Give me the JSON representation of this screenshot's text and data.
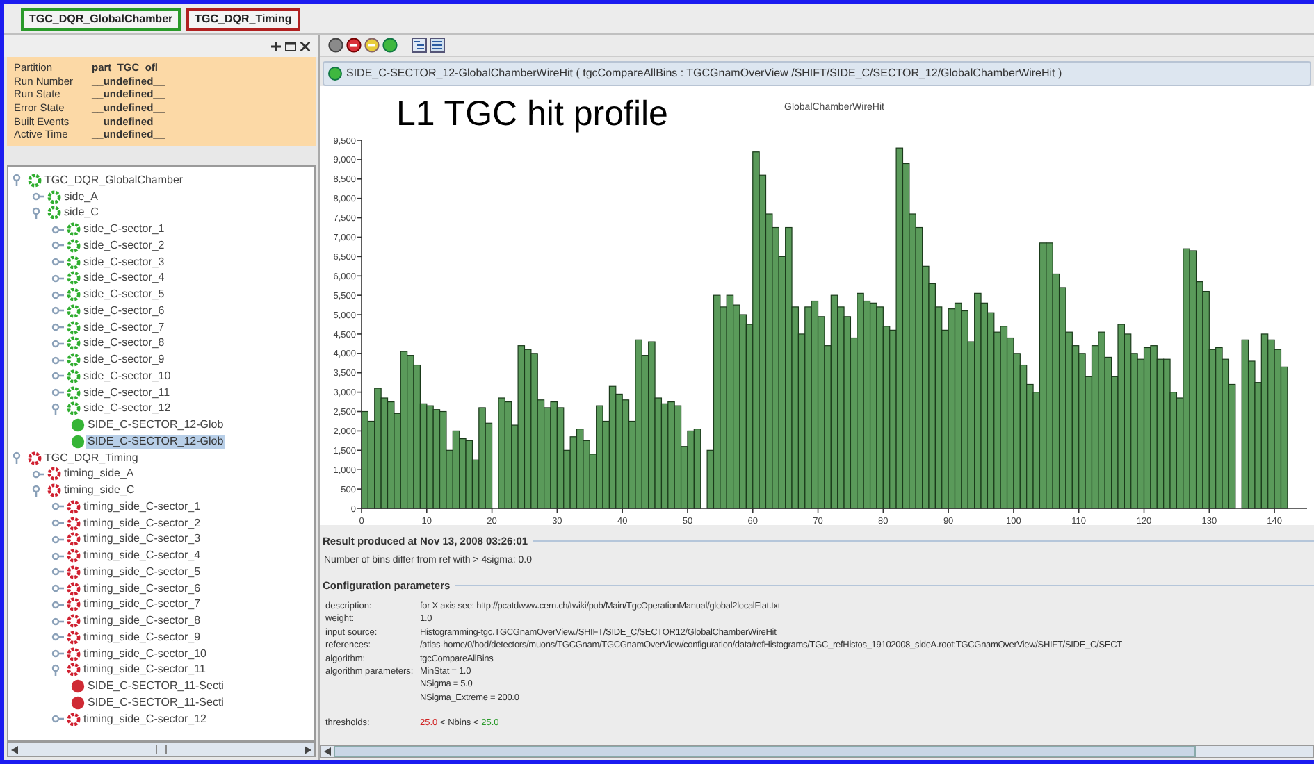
{
  "tabs": [
    {
      "label": "TGC_DQR_GlobalChamber",
      "color": "#2a9a2a"
    },
    {
      "label": "TGC_DQR_Timing",
      "color": "#b02020"
    }
  ],
  "status_panel": {
    "rows": [
      {
        "label": "Partition",
        "value": "part_TGC_ofl"
      },
      {
        "label": "Run Number",
        "value": "__undefined__"
      },
      {
        "label": "Run State",
        "value": "__undefined__"
      },
      {
        "label": "Error State",
        "value": "__undefined__"
      },
      {
        "label": "Built Events",
        "value": "__undefined__"
      },
      {
        "label": "Active Time",
        "value": "__undefined__"
      }
    ]
  },
  "tree": [
    {
      "label": "TGC_DQR_GlobalChamber",
      "kind": "group",
      "color": "#2fae2f",
      "expanded": true,
      "selected": false,
      "children": [
        {
          "label": "side_A",
          "kind": "group",
          "color": "#2fae2f",
          "expanded": false,
          "selected": false
        },
        {
          "label": "side_C",
          "kind": "group",
          "color": "#2fae2f",
          "expanded": true,
          "selected": false,
          "children": [
            {
              "label": "side_C-sector_1",
              "kind": "group",
              "color": "#2fae2f",
              "expanded": false,
              "selected": false
            },
            {
              "label": "side_C-sector_2",
              "kind": "group",
              "color": "#2fae2f",
              "expanded": false,
              "selected": false
            },
            {
              "label": "side_C-sector_3",
              "kind": "group",
              "color": "#2fae2f",
              "expanded": false,
              "selected": false
            },
            {
              "label": "side_C-sector_4",
              "kind": "group",
              "color": "#2fae2f",
              "expanded": false,
              "selected": false
            },
            {
              "label": "side_C-sector_5",
              "kind": "group",
              "color": "#2fae2f",
              "expanded": false,
              "selected": false
            },
            {
              "label": "side_C-sector_6",
              "kind": "group",
              "color": "#2fae2f",
              "expanded": false,
              "selected": false
            },
            {
              "label": "side_C-sector_7",
              "kind": "group",
              "color": "#2fae2f",
              "expanded": false,
              "selected": false
            },
            {
              "label": "side_C-sector_8",
              "kind": "group",
              "color": "#2fae2f",
              "expanded": false,
              "selected": false
            },
            {
              "label": "side_C-sector_9",
              "kind": "group",
              "color": "#2fae2f",
              "expanded": false,
              "selected": false
            },
            {
              "label": "side_C-sector_10",
              "kind": "group",
              "color": "#2fae2f",
              "expanded": false,
              "selected": false
            },
            {
              "label": "side_C-sector_11",
              "kind": "group",
              "color": "#2fae2f",
              "expanded": false,
              "selected": false
            },
            {
              "label": "side_C-sector_12",
              "kind": "group",
              "color": "#2fae2f",
              "expanded": true,
              "selected": false,
              "children": [
                {
                  "label": "SIDE_C-SECTOR_12-Glob",
                  "kind": "leaf",
                  "color": "#36b536",
                  "selected": false
                },
                {
                  "label": "SIDE_C-SECTOR_12-Glob",
                  "kind": "leaf",
                  "color": "#36b536",
                  "selected": true
                }
              ]
            }
          ]
        }
      ]
    },
    {
      "label": "TGC_DQR_Timing",
      "kind": "group",
      "color": "#d02030",
      "expanded": true,
      "selected": false,
      "children": [
        {
          "label": "timing_side_A",
          "kind": "group",
          "color": "#d02030",
          "expanded": false,
          "selected": false
        },
        {
          "label": "timing_side_C",
          "kind": "group",
          "color": "#d02030",
          "expanded": true,
          "selected": false,
          "children": [
            {
              "label": "timing_side_C-sector_1",
              "kind": "group",
              "color": "#d02030",
              "expanded": false,
              "selected": false
            },
            {
              "label": "timing_side_C-sector_2",
              "kind": "group",
              "color": "#d02030",
              "expanded": false,
              "selected": false
            },
            {
              "label": "timing_side_C-sector_3",
              "kind": "group",
              "color": "#d02030",
              "expanded": false,
              "selected": false
            },
            {
              "label": "timing_side_C-sector_4",
              "kind": "group",
              "color": "#d02030",
              "expanded": false,
              "selected": false
            },
            {
              "label": "timing_side_C-sector_5",
              "kind": "group",
              "color": "#d02030",
              "expanded": false,
              "selected": false
            },
            {
              "label": "timing_side_C-sector_6",
              "kind": "group",
              "color": "#d02030",
              "expanded": false,
              "selected": false
            },
            {
              "label": "timing_side_C-sector_7",
              "kind": "group",
              "color": "#d02030",
              "expanded": false,
              "selected": false
            },
            {
              "label": "timing_side_C-sector_8",
              "kind": "group",
              "color": "#d02030",
              "expanded": false,
              "selected": false
            },
            {
              "label": "timing_side_C-sector_9",
              "kind": "group",
              "color": "#d02030",
              "expanded": false,
              "selected": false
            },
            {
              "label": "timing_side_C-sector_10",
              "kind": "group",
              "color": "#d02030",
              "expanded": false,
              "selected": false
            },
            {
              "label": "timing_side_C-sector_11",
              "kind": "group",
              "color": "#d02030",
              "expanded": true,
              "selected": false,
              "children": [
                {
                  "label": "SIDE_C-SECTOR_11-Secti",
                  "kind": "leaf",
                  "color": "#cf2a34",
                  "selected": false
                },
                {
                  "label": "SIDE_C-SECTOR_11-Secti",
                  "kind": "leaf",
                  "color": "#cf2a34",
                  "selected": false
                }
              ]
            },
            {
              "label": "timing_side_C-sector_12",
              "kind": "group",
              "color": "#d02030",
              "expanded": false,
              "selected": false
            }
          ]
        }
      ]
    }
  ],
  "histogram": {
    "header": "SIDE_C-SECTOR_12-GlobalChamberWireHit ( tgcCompareAllBins : TGCGnamOverView /SHIFT/SIDE_C/SECTOR_12/GlobalChamberWireHit )",
    "overlay_label": "L1 TGC hit profile",
    "chart_data": {
      "type": "bar",
      "title": "GlobalChamberWireHit",
      "xlim": [
        0,
        145
      ],
      "ylim": [
        0,
        9500
      ],
      "x": [
        0.5,
        1.5,
        2.5,
        3.5,
        4.5,
        5.5,
        6.5,
        7.5,
        8.5,
        9.5,
        10.5,
        11.5,
        12.5,
        13.5,
        14.5,
        15.5,
        16.5,
        17.5,
        18.5,
        19.5,
        20.5,
        21.5,
        22.5,
        23.5,
        24.5,
        25.5,
        26.5,
        27.5,
        28.5,
        29.5,
        30.5,
        31.5,
        32.5,
        33.5,
        34.5,
        35.5,
        36.5,
        37.5,
        38.5,
        39.5,
        40.5,
        41.5,
        42.5,
        43.5,
        44.5,
        45.5,
        46.5,
        47.5,
        48.5,
        49.5,
        50.5,
        51.5,
        52.5,
        53.5,
        54.5,
        55.5,
        56.5,
        57.5,
        58.5,
        59.5,
        60.5,
        61.5,
        62.5,
        63.5,
        64.5,
        65.5,
        66.5,
        67.5,
        68.5,
        69.5,
        70.5,
        71.5,
        72.5,
        73.5,
        74.5,
        75.5,
        76.5,
        77.5,
        78.5,
        79.5,
        80.5,
        81.5,
        82.5,
        83.5,
        84.5,
        85.5,
        86.5,
        87.5,
        88.5,
        89.5,
        90.5,
        91.5,
        92.5,
        93.5,
        94.5,
        95.5,
        96.5,
        97.5,
        98.5,
        99.5,
        100.5,
        101.5,
        102.5,
        103.5,
        104.5,
        105.5,
        106.5,
        107.5,
        108.5,
        109.5,
        110.5,
        111.5,
        112.5,
        113.5,
        114.5,
        115.5,
        116.5,
        117.5,
        118.5,
        119.5,
        120.5,
        121.5,
        122.5,
        123.5,
        124.5,
        125.5,
        126.5,
        127.5,
        128.5,
        129.5,
        130.5,
        131.5,
        132.5,
        133.5,
        134.5,
        135.5,
        136.5,
        137.5,
        138.5,
        139.5,
        140.5,
        141.5
      ],
      "xticks": [
        0,
        10,
        20,
        30,
        40,
        50,
        60,
        70,
        80,
        90,
        100,
        110,
        120,
        130,
        140
      ],
      "yticks": [
        {
          "value": 0,
          "label": "0"
        },
        {
          "value": 500,
          "label": "500"
        },
        {
          "value": 1000,
          "label": "1,000"
        },
        {
          "value": 1500,
          "label": "1,500"
        },
        {
          "value": 2000,
          "label": "2,000"
        },
        {
          "value": 2500,
          "label": "2,500"
        },
        {
          "value": 3000,
          "label": "3,000"
        },
        {
          "value": 3500,
          "label": "3,500"
        },
        {
          "value": 4000,
          "label": "4,000"
        },
        {
          "value": 4500,
          "label": "4,500"
        },
        {
          "value": 5000,
          "label": "5,000"
        },
        {
          "value": 5500,
          "label": "5,500"
        },
        {
          "value": 6000,
          "label": "6,000"
        },
        {
          "value": 6500,
          "label": "6,500"
        },
        {
          "value": 7000,
          "label": "7,000"
        },
        {
          "value": 7500,
          "label": "7,500"
        },
        {
          "value": 8000,
          "label": "8,000"
        },
        {
          "value": 8500,
          "label": "8,500"
        },
        {
          "value": 9000,
          "label": "9,000"
        },
        {
          "value": 9500,
          "label": "9,500"
        }
      ],
      "series": [
        {
          "color": "#5a9a5a",
          "values": [
            2500,
            2250,
            3100,
            2850,
            2750,
            2450,
            4050,
            3950,
            3700,
            2700,
            2650,
            2550,
            2500,
            1500,
            2000,
            1800,
            1750,
            1250,
            2600,
            2200,
            0,
            2850,
            2750,
            2150,
            4200,
            4100,
            4000,
            2800,
            2600,
            2750,
            2600,
            1500,
            1850,
            2050,
            1750,
            1400,
            2650,
            2250,
            3150,
            2950,
            2800,
            2250,
            4350,
            3950,
            4300,
            2850,
            2700,
            2750,
            2650,
            1600,
            2000,
            2050,
            0,
            1500,
            5500,
            5200,
            5500,
            5250,
            5000,
            4750,
            9200,
            8600,
            7600,
            7250,
            6500,
            7250,
            5200,
            4500,
            5200,
            5350,
            4950,
            4200,
            5500,
            5200,
            4950,
            4400,
            5550,
            5350,
            5300,
            5200,
            4700,
            4600,
            9300,
            8900,
            7600,
            7250,
            6250,
            5800,
            5200,
            4600,
            5150,
            5300,
            5100,
            4300,
            5550,
            5300,
            5050,
            4550,
            4700,
            4400,
            4000,
            3700,
            3200,
            3000,
            6850,
            6850,
            6050,
            5700,
            4550,
            4200,
            4000,
            3400,
            4200,
            4550,
            3900,
            3400,
            4750,
            4500,
            4000,
            3850,
            4150,
            4200,
            3850,
            3850,
            3000,
            2850,
            6700,
            6650,
            5850,
            5600,
            4100,
            4150,
            3850,
            3200,
            0,
            4350,
            3800,
            3250,
            4500,
            4350,
            4100,
            3650
          ]
        }
      ]
    }
  },
  "result": {
    "heading": "Result produced at Nov 13, 2008 03:26:01",
    "line": "Number of bins differ from ref with > 4sigma:  0.0"
  },
  "configuration": {
    "heading": "Configuration parameters",
    "params": [
      {
        "label": "description:",
        "lines": [
          "for X axis see: http://pcatdwww.cern.ch/twiki/pub/Main/TgcOperationManual/global2localFlat.txt"
        ]
      },
      {
        "label": "weight:",
        "lines": [
          "1.0"
        ]
      },
      {
        "label": "input source:",
        "lines": [
          "Histogramming-tgc.TGCGnamOverView./SHIFT/SIDE_C/SECTOR12/GlobalChamberWireHit"
        ]
      },
      {
        "label": "references:",
        "lines": [
          "/atlas-home/0/hod/detectors/muons/TGCGnam/TGCGnamOverView/configuration/data/refHistograms/TGC_refHistos_19102008_sideA.root:TGCGnamOverView/SHIFT/SIDE_C/SECT"
        ]
      },
      {
        "label": "algorithm:",
        "lines": [
          "tgcCompareAllBins"
        ]
      },
      {
        "label": "algorithm parameters:",
        "lines": [
          "MinStat = 1.0",
          "NSigma = 5.0",
          "NSigma_Extreme = 200.0"
        ]
      }
    ],
    "thresholds": {
      "label": "thresholds:",
      "low": "25.0",
      "middle": " < Nbins < ",
      "high": "25.0"
    }
  }
}
